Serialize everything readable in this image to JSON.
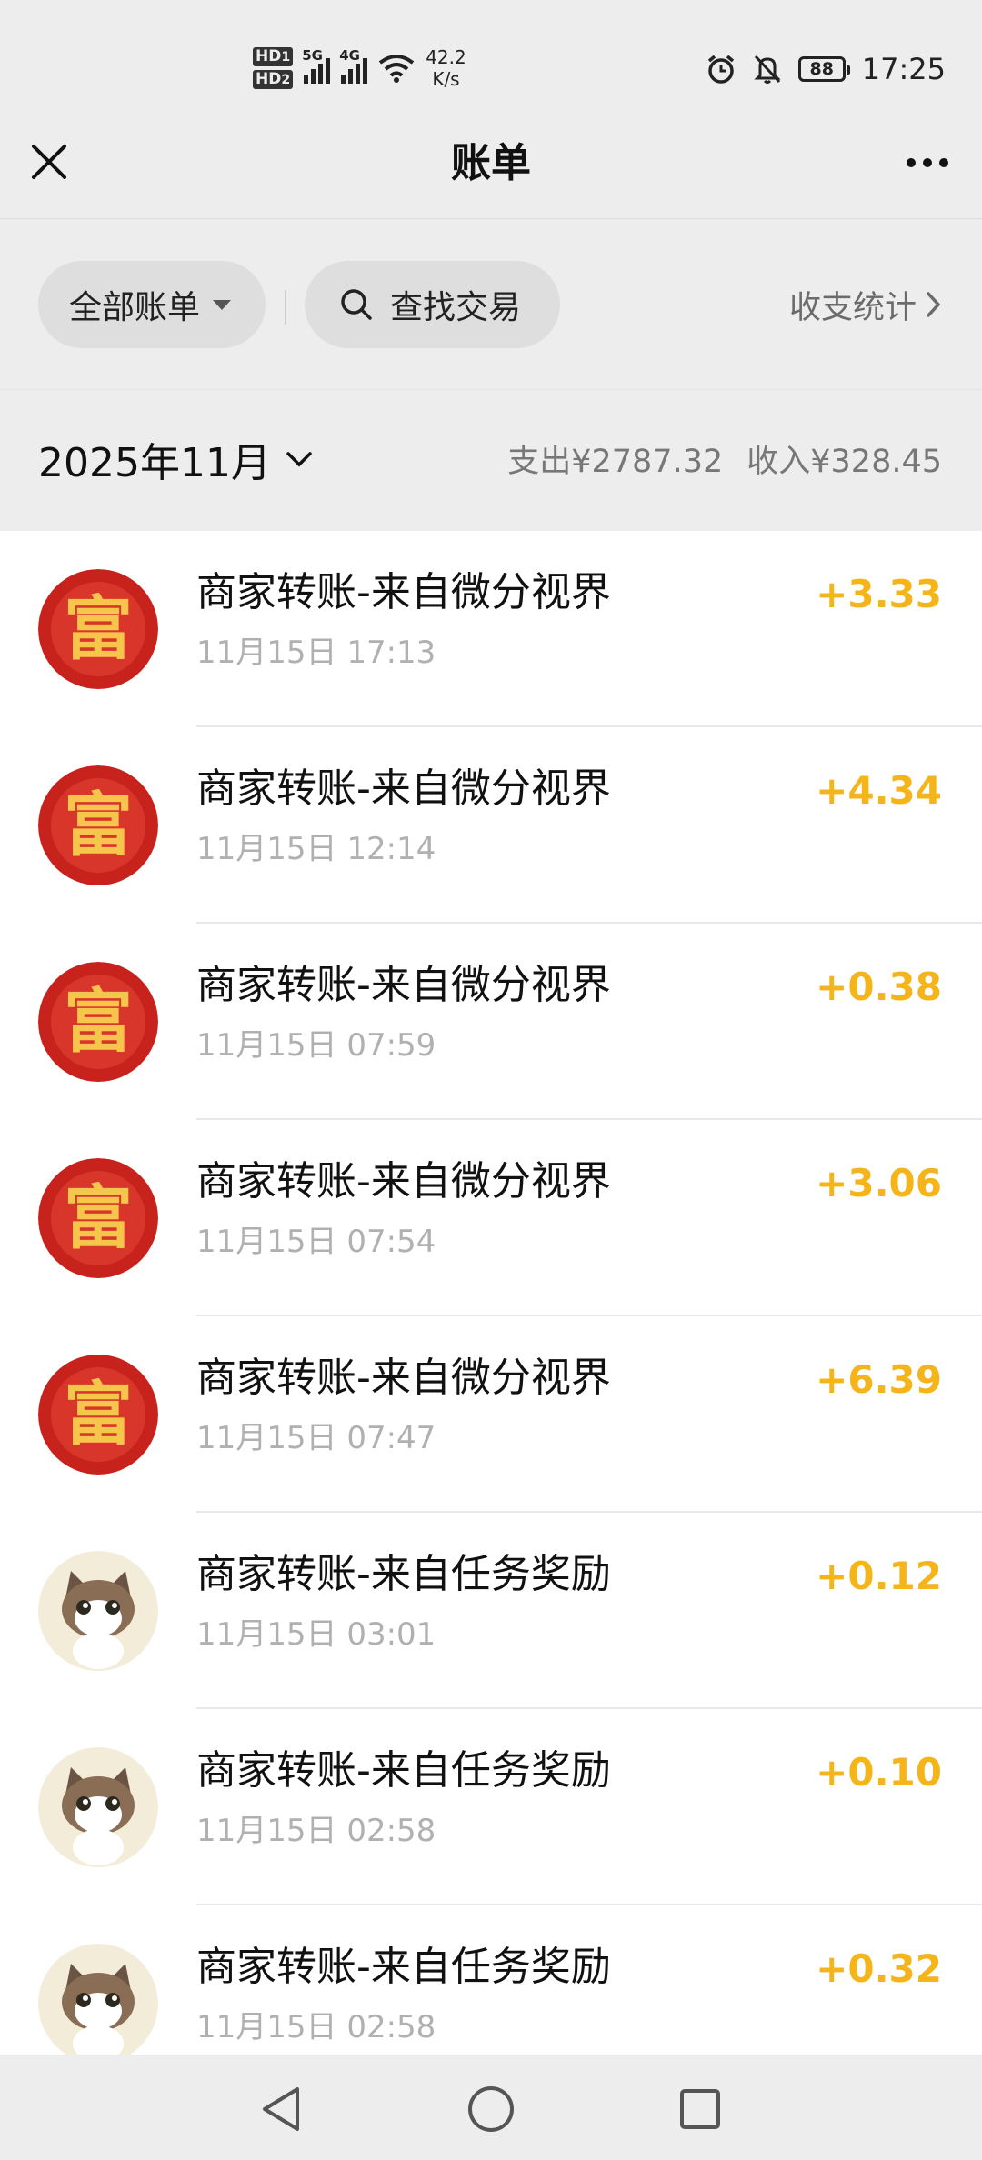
{
  "status_bar": {
    "hd1": "HD",
    "hd1_sub": "1",
    "hd2": "HD",
    "hd2_sub": "2",
    "net1": "5G",
    "net2": "4G",
    "speed_value": "42.2",
    "speed_unit": "K/s",
    "battery": "88",
    "time": "17:25"
  },
  "header": {
    "title": "账单",
    "close_icon": "close-icon",
    "more_icon": "more-icon"
  },
  "filters": {
    "all_bills_label": "全部账单",
    "search_label": "查找交易",
    "stats_label": "收支统计"
  },
  "month": {
    "label": "2025年11月",
    "expense_label": "支出",
    "expense_value": "¥2787.32",
    "income_label": "收入",
    "income_value": "¥328.45"
  },
  "transactions": [
    {
      "avatar": "fu-avatar",
      "title": "商家转账-来自微分视界",
      "time": "11月15日 17:13",
      "amount": "+3.33"
    },
    {
      "avatar": "fu-avatar",
      "title": "商家转账-来自微分视界",
      "time": "11月15日 12:14",
      "amount": "+4.34"
    },
    {
      "avatar": "fu-avatar",
      "title": "商家转账-来自微分视界",
      "time": "11月15日 07:59",
      "amount": "+0.38"
    },
    {
      "avatar": "fu-avatar",
      "title": "商家转账-来自微分视界",
      "time": "11月15日 07:54",
      "amount": "+3.06"
    },
    {
      "avatar": "fu-avatar",
      "title": "商家转账-来自微分视界",
      "time": "11月15日 07:47",
      "amount": "+6.39"
    },
    {
      "avatar": "cat-avatar",
      "title": "商家转账-来自任务奖励",
      "time": "11月15日 03:01",
      "amount": "+0.12"
    },
    {
      "avatar": "cat-avatar",
      "title": "商家转账-来自任务奖励",
      "time": "11月15日 02:58",
      "amount": "+0.10"
    },
    {
      "avatar": "cat-avatar",
      "title": "商家转账-来自任务奖励",
      "time": "11月15日 02:58",
      "amount": "+0.32"
    }
  ],
  "colors": {
    "income_amount": "#f4b41a",
    "background": "#ededed",
    "list_background": "#ffffff"
  },
  "nav": {
    "back_icon": "back-triangle-icon",
    "home_icon": "home-circle-icon",
    "recents_icon": "recents-square-icon"
  }
}
